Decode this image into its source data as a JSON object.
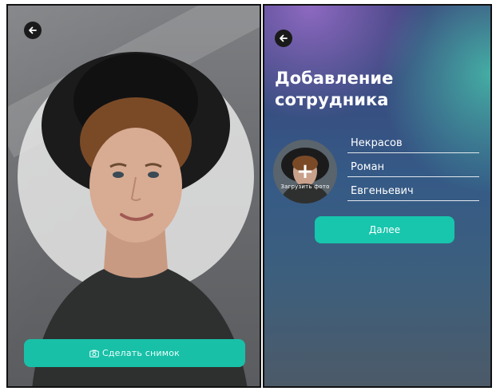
{
  "camera_screen": {
    "shoot_button_label": "Сделать снимок",
    "back_icon": "arrow-left-icon",
    "camera_icon": "camera-icon"
  },
  "form_screen": {
    "title_line1": "Добавление",
    "title_line2": "сотрудника",
    "avatar_caption": "Загрузить фото",
    "avatar_action_icon": "plus-icon",
    "fields": {
      "last_name": "Некрасов",
      "first_name": "Роман",
      "patronymic": "Евгеньевич"
    },
    "next_button_label": "Далее"
  },
  "colors": {
    "accent": "#19c0a8",
    "icon_bg": "#1a1a1a"
  }
}
